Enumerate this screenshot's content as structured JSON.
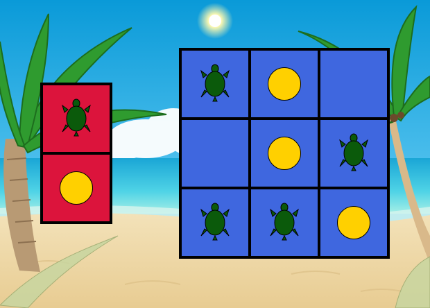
{
  "colors": {
    "side_panel": "#dc143c",
    "board": "#3f67df",
    "coin": "#ffd000",
    "turtle": "#0b5a0b"
  },
  "side_panel": {
    "cells": [
      "turtle",
      "coin"
    ]
  },
  "board": {
    "rows": 3,
    "cols": 3,
    "cells": [
      [
        "turtle",
        "coin",
        "empty"
      ],
      [
        "empty",
        "coin",
        "turtle"
      ],
      [
        "turtle",
        "turtle",
        "coin"
      ]
    ]
  },
  "icons": {
    "turtle": "turtle-icon",
    "coin": "coin-icon",
    "sun": "sun-icon",
    "palm": "palm-tree-icon"
  }
}
